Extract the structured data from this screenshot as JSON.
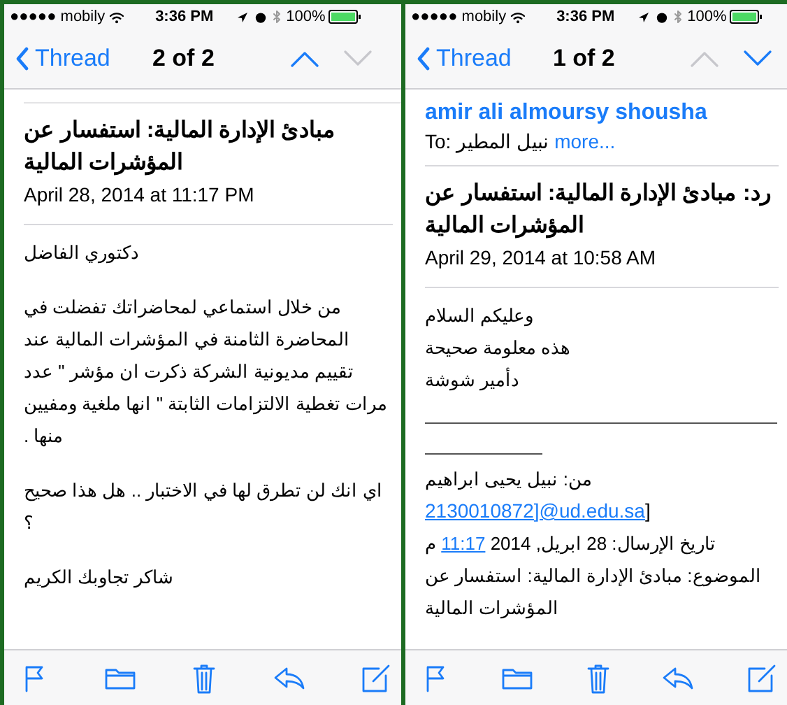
{
  "left_screen": {
    "status": {
      "carrier": "●●●●● mobily",
      "time": "3:36 PM",
      "battery": "100%"
    },
    "nav": {
      "back": "Thread",
      "title": "2 of 2",
      "up_enabled": true,
      "down_enabled": false
    },
    "subject": "مبادئ الإدارة المالية: استفسار عن المؤشرات المالية",
    "date": "April 28, 2014 at 11:17 PM",
    "body": [
      {
        "kind": "paragraph",
        "text": "دكتوري الفاضل"
      },
      {
        "kind": "paragraph",
        "text": "من خلال استماعي لمحاضراتك تفضلت في المحاضرة الثامنة في المؤشرات المالية عند تقييم مديونية الشركة ذكرت ان مؤشر \" عدد مرات تغطية الالتزامات الثابتة \" انها ملغية ومفيين منها ."
      },
      {
        "kind": "paragraph",
        "text": "اي انك لن تطرق لها في الاختبار .. هل هذا صحيح ؟"
      },
      {
        "kind": "line",
        "text": "شاكر تجاوبك الكريم"
      }
    ]
  },
  "right_screen": {
    "status": {
      "carrier": "●●●●● mobily",
      "time": "3:36 PM",
      "battery": "100%"
    },
    "nav": {
      "back": "Thread",
      "title": "1 of 2",
      "up_enabled": false,
      "down_enabled": true
    },
    "sender": "amir ali almoursy shousha",
    "to": {
      "label": "To:",
      "name": "نبيل المطير",
      "more": "more..."
    },
    "subject": "رد: مبادئ الإدارة المالية: استفسار عن المؤشرات المالية",
    "date": "April 29, 2014 at 10:58 AM",
    "body": [
      {
        "kind": "line",
        "text": "وعليكم السلام"
      },
      {
        "kind": "line",
        "text": "هذه معلومة صحيحة"
      },
      {
        "kind": "line",
        "text": "دأمير شوشة"
      },
      {
        "kind": "rule"
      },
      {
        "kind": "line",
        "text": "من: نبيل يحيى ابراهيم"
      },
      {
        "kind": "email",
        "link": "2130010872]@ud.edu.sa",
        "after": "]"
      },
      {
        "kind": "linked",
        "before": "تاريخ الإرسال: 28 ابريل, 2014",
        "link": "11:17",
        "after": "م"
      },
      {
        "kind": "line",
        "text": "الموضوع: مبادئ الإدارة المالية: استفسار عن المؤشرات المالية"
      }
    ]
  }
}
